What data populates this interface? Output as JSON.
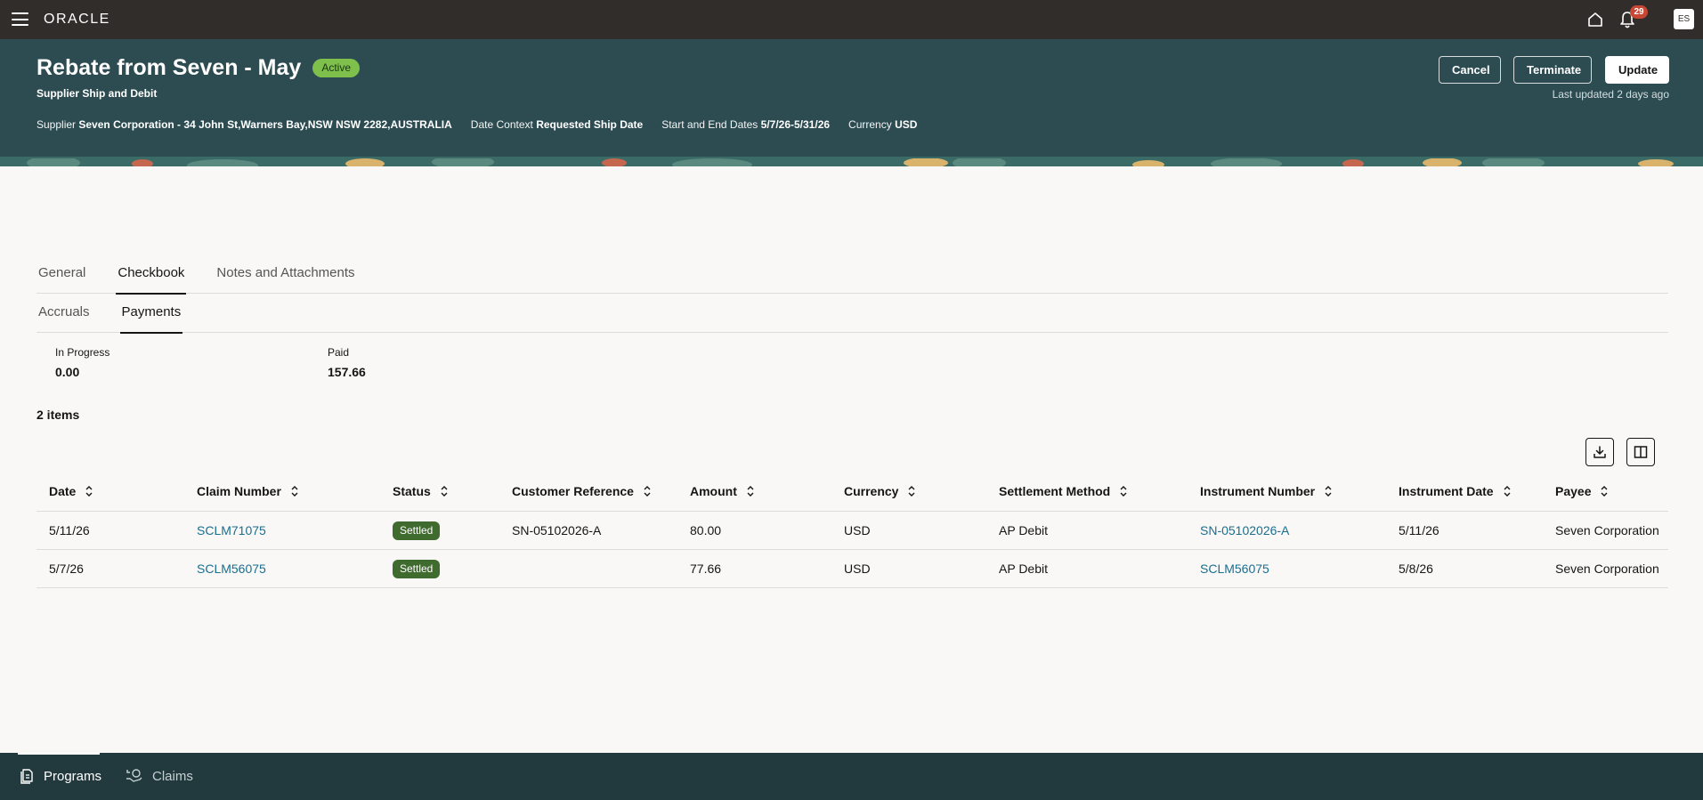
{
  "topbar": {
    "logo": "ORACLE",
    "notification_count": "29",
    "avatar_initials": "ES"
  },
  "header": {
    "title": "Rebate from Seven - May",
    "status": "Active",
    "subtitle": "Supplier Ship and Debit",
    "supplier_label": "Supplier",
    "supplier_value": "Seven Corporation - 34 John St,Warners Bay,NSW NSW 2282,AUSTRALIA",
    "date_context_label": "Date Context",
    "date_context_value": "Requested Ship Date",
    "dates_label": "Start and End Dates",
    "dates_value": "5/7/26-5/31/26",
    "currency_label": "Currency",
    "currency_value": "USD",
    "buttons": {
      "cancel": "Cancel",
      "terminate": "Terminate",
      "update": "Update"
    },
    "last_updated": "Last updated 2 days ago"
  },
  "tabs": {
    "general": "General",
    "checkbook": "Checkbook",
    "notes": "Notes and Attachments"
  },
  "subtabs": {
    "accruals": "Accruals",
    "payments": "Payments"
  },
  "summary": {
    "in_progress_label": "In Progress",
    "in_progress_value": "0.00",
    "paid_label": "Paid",
    "paid_value": "157.66"
  },
  "items_count": "2 items",
  "table": {
    "headers": {
      "date": "Date",
      "claim_number": "Claim Number",
      "status": "Status",
      "customer_reference": "Customer Reference",
      "amount": "Amount",
      "currency": "Currency",
      "settlement_method": "Settlement Method",
      "instrument_number": "Instrument Number",
      "instrument_date": "Instrument Date",
      "payee": "Payee"
    },
    "rows": [
      {
        "date": "5/11/26",
        "claim_number": "SCLM71075",
        "status": "Settled",
        "customer_reference": "SN-05102026-A",
        "amount": "80.00",
        "currency": "USD",
        "settlement_method": "AP Debit",
        "instrument_number": "SN-05102026-A",
        "instrument_date": "5/11/26",
        "payee": "Seven Corporation"
      },
      {
        "date": "5/7/26",
        "claim_number": "SCLM56075",
        "status": "Settled",
        "customer_reference": "",
        "amount": "77.66",
        "currency": "USD",
        "settlement_method": "AP Debit",
        "instrument_number": "SCLM56075",
        "instrument_date": "5/8/26",
        "payee": "Seven Corporation"
      }
    ]
  },
  "bottom_nav": {
    "programs": "Programs",
    "claims": "Claims"
  },
  "colors": {
    "topbar": "#312d2a",
    "header": "#2c4c52",
    "active_pill": "#7fbf4c",
    "settled_badge": "#3f6b2e",
    "link": "#1a6e8f",
    "bottom_nav": "#22393d"
  }
}
